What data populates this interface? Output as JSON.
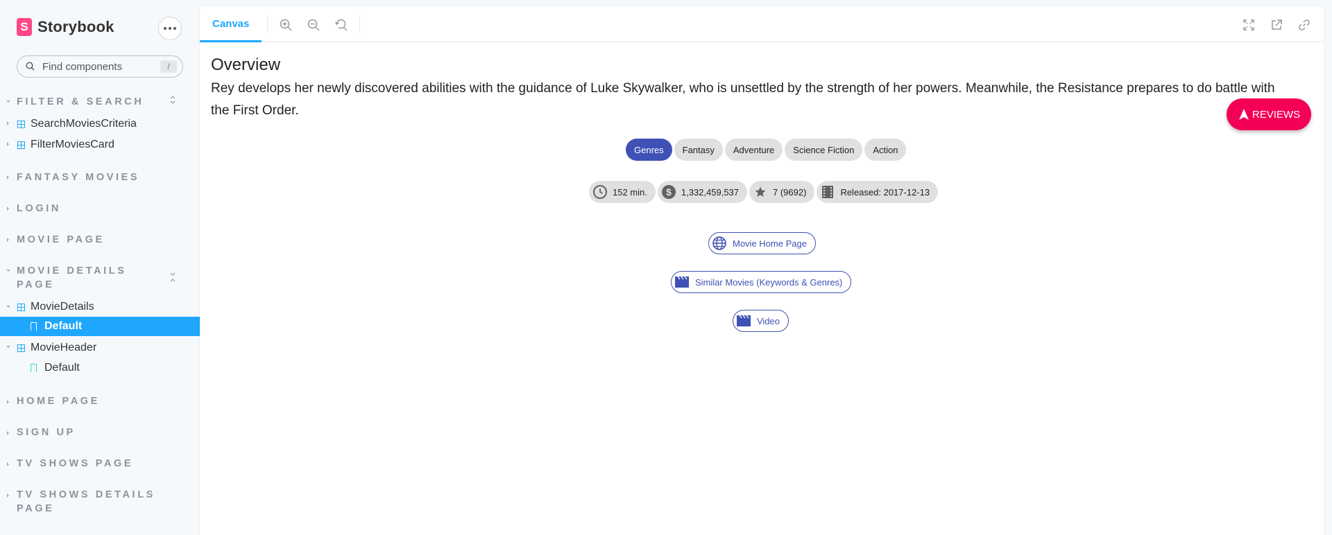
{
  "brand": {
    "logo_letter": "S",
    "name": "Storybook",
    "accent": "#ff4785"
  },
  "search": {
    "placeholder": "Find components",
    "shortcut": "/"
  },
  "sidebar": {
    "groups": [
      {
        "label": "FILTER & SEARCH",
        "items": [
          "SearchMoviesCriteria",
          "FilterMoviesCard"
        ]
      },
      {
        "label": "FANTASY MOVIES"
      },
      {
        "label": "LOGIN"
      },
      {
        "label": "MOVIE PAGE"
      },
      {
        "label": "MOVIE DETAILS PAGE",
        "items": [
          {
            "component": "MovieDetails",
            "stories": [
              "Default"
            ]
          },
          {
            "component": "MovieHeader",
            "stories": [
              "Default"
            ]
          }
        ]
      },
      {
        "label": "HOME PAGE"
      },
      {
        "label": "SIGN UP"
      },
      {
        "label": "TV SHOWS PAGE"
      },
      {
        "label": "TV SHOWS DETAILS PAGE"
      }
    ],
    "active_story": "MovieDetails / Default",
    "active_color": "#1ea7fd"
  },
  "toolbar": {
    "canvas_tab": "Canvas",
    "icons": [
      "zoom-in-icon",
      "zoom-out-icon",
      "zoom-reset-icon",
      "fullscreen-icon",
      "open-new-tab-icon",
      "copy-link-icon"
    ]
  },
  "movie": {
    "overview_title": "Overview",
    "overview": "Rey develops her newly discovered abilities with the guidance of Luke Skywalker, who is unsettled by the strength of her powers. Meanwhile, the Resistance prepares to do battle with the First Order.",
    "genres_label": "Genres",
    "genres": [
      "Fantasy",
      "Adventure",
      "Science Fiction",
      "Action"
    ],
    "runtime": "152 min.",
    "revenue": "1,332,459,537",
    "rating": "7 (9692)",
    "released": "Released: 2017-12-13",
    "links": {
      "home_page": "Movie Home Page",
      "similar": "Similar Movies (Keywords & Genres)",
      "video": "Video"
    },
    "reviews_button": "REVIEWS",
    "primary_color": "#3f51b5",
    "reviews_color": "#f50057"
  }
}
